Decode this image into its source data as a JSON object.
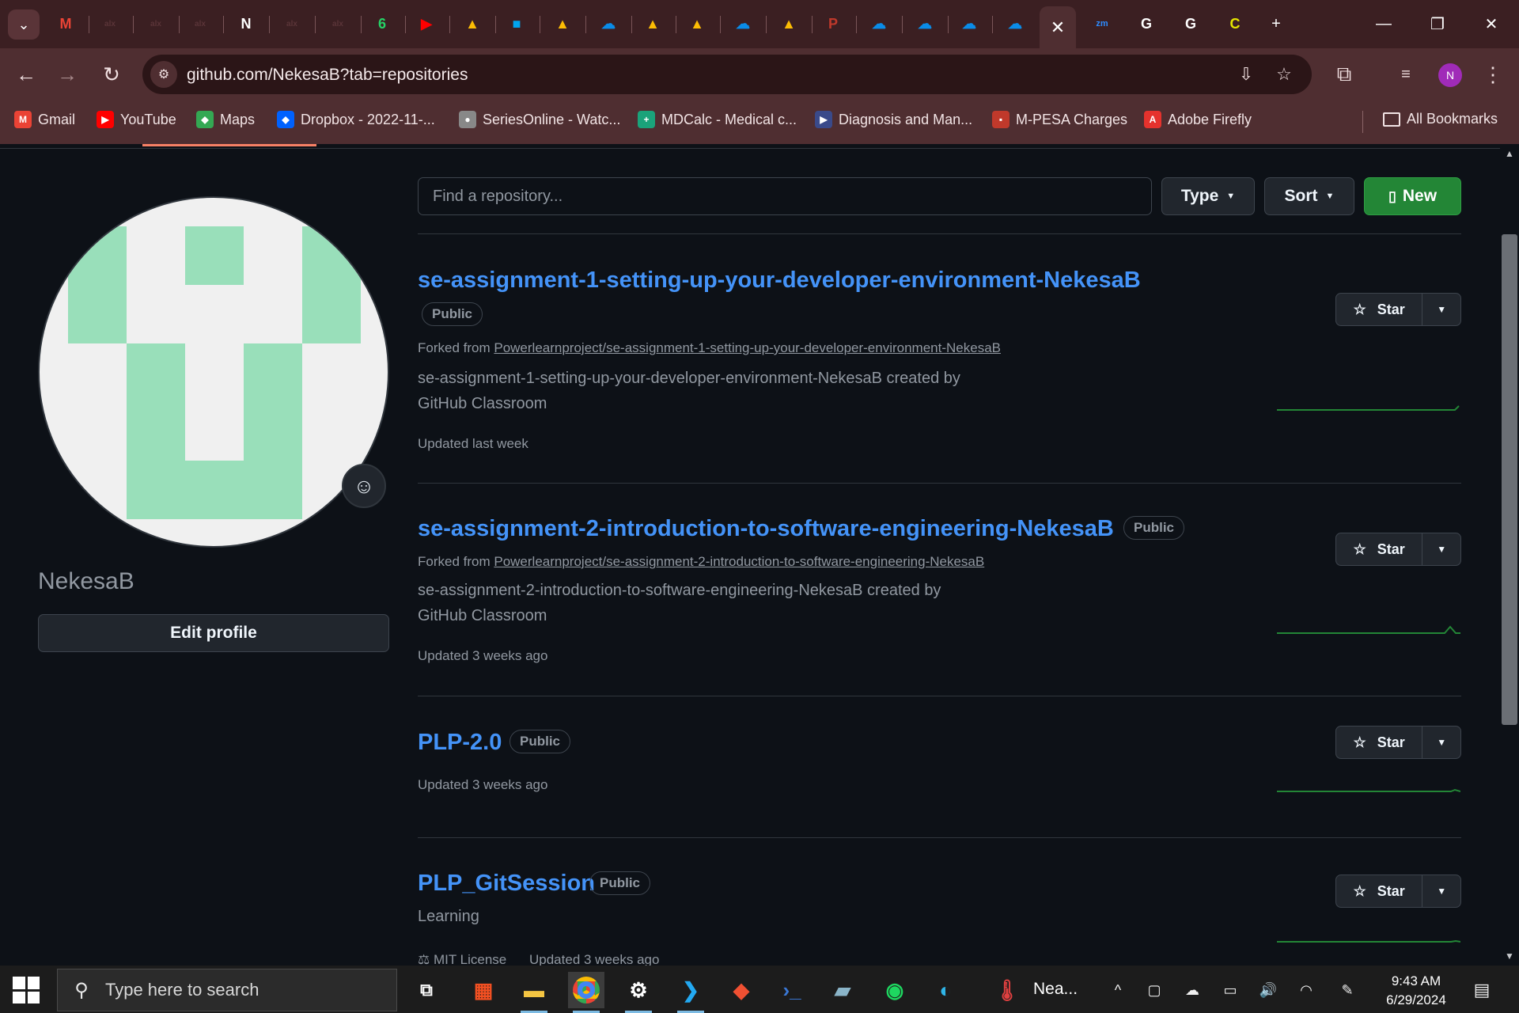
{
  "browser": {
    "active_tab_close": "✕",
    "new_tab": "+",
    "url": "github.com/NekesaB?tab=repositories",
    "profile_initial": "N",
    "tab_favicons": [
      {
        "name": "gmail",
        "color": "#ea4335",
        "glyph": "M"
      },
      {
        "name": "alx-1",
        "color": "#5a3438",
        "glyph": "alx"
      },
      {
        "name": "alx-2",
        "color": "#5a3438",
        "glyph": "alx"
      },
      {
        "name": "alx-3",
        "color": "#5a3438",
        "glyph": "alx"
      },
      {
        "name": "notion",
        "color": "#ffffff",
        "glyph": "N"
      },
      {
        "name": "alx-4",
        "color": "#5a3438",
        "glyph": "alx"
      },
      {
        "name": "alx-5",
        "color": "#5a3438",
        "glyph": "alx"
      },
      {
        "name": "whatsapp",
        "color": "#25d366",
        "glyph": "6"
      },
      {
        "name": "youtube",
        "color": "#ff0000",
        "glyph": "▶"
      },
      {
        "name": "drive-1",
        "color": "#fbbc04",
        "glyph": "▲"
      },
      {
        "name": "microsoft",
        "color": "#00a4ef",
        "glyph": "■"
      },
      {
        "name": "drive-2",
        "color": "#fbbc04",
        "glyph": "▲"
      },
      {
        "name": "onedrive-1",
        "color": "#0a8ce8",
        "glyph": "☁"
      },
      {
        "name": "drive-3",
        "color": "#fbbc04",
        "glyph": "▲"
      },
      {
        "name": "drive-4",
        "color": "#fbbc04",
        "glyph": "▲"
      },
      {
        "name": "onedrive-2",
        "color": "#0a8ce8",
        "glyph": "☁"
      },
      {
        "name": "drive-5",
        "color": "#fbbc04",
        "glyph": "▲"
      },
      {
        "name": "pesa",
        "color": "#c0392b",
        "glyph": "P"
      },
      {
        "name": "onedrive-3",
        "color": "#0a8ce8",
        "glyph": "☁"
      },
      {
        "name": "onedrive-4",
        "color": "#0a8ce8",
        "glyph": "☁"
      },
      {
        "name": "onedrive-5",
        "color": "#0a8ce8",
        "glyph": "☁"
      },
      {
        "name": "onedrive-6",
        "color": "#0a8ce8",
        "glyph": "☁"
      }
    ],
    "tab_favicons_right": [
      {
        "name": "zoom",
        "color": "#2d8cff",
        "glyph": "zm"
      },
      {
        "name": "google-1",
        "color": "#ffffff",
        "glyph": "G"
      },
      {
        "name": "google-2",
        "color": "#ffffff",
        "glyph": "G"
      },
      {
        "name": "extension-yellow",
        "color": "#e6e600",
        "glyph": "C"
      }
    ],
    "bookmarks": [
      {
        "label": "Gmail",
        "color": "#ea4335",
        "glyph": "M"
      },
      {
        "label": "YouTube",
        "color": "#ff0000",
        "glyph": "▶"
      },
      {
        "label": "Maps",
        "color": "#34a853",
        "glyph": "◆"
      },
      {
        "label": "Dropbox - 2022-11-...",
        "color": "#0061fe",
        "glyph": "◆"
      },
      {
        "label": "SeriesOnline - Watc...",
        "color": "#888888",
        "glyph": "●"
      },
      {
        "label": "MDCalc - Medical c...",
        "color": "#1aa37a",
        "glyph": "+"
      },
      {
        "label": "Diagnosis and Man...",
        "color": "#3a4a8a",
        "glyph": "▶"
      },
      {
        "label": "M-PESA Charges",
        "color": "#c0392b",
        "glyph": "▪"
      },
      {
        "label": "Adobe Firefly",
        "color": "#e5322d",
        "glyph": "A"
      }
    ],
    "all_bookmarks": "All Bookmarks"
  },
  "profile": {
    "username": "NekesaB",
    "edit_profile": "Edit profile"
  },
  "filters": {
    "search_placeholder": "Find a repository...",
    "type_label": "Type",
    "sort_label": "Sort",
    "new_label": "New"
  },
  "repositories": [
    {
      "name": "se-assignment-1-setting-up-your-developer-environment-NekesaB",
      "visibility": "Public",
      "forked_prefix": "Forked from ",
      "forked_from": "Powerlearnproject/se-assignment-1-setting-up-your-developer-environment-NekesaB",
      "description": "se-assignment-1-setting-up-your-developer-environment-NekesaB created by GitHub Classroom",
      "updated": "Updated last week",
      "star_label": "Star"
    },
    {
      "name": "se-assignment-2-introduction-to-software-engineering-NekesaB",
      "visibility": "Public",
      "forked_prefix": "Forked from ",
      "forked_from": "Powerlearnproject/se-assignment-2-introduction-to-software-engineering-NekesaB",
      "description": "se-assignment-2-introduction-to-software-engineering-NekesaB created by GitHub Classroom",
      "updated": "Updated 3 weeks ago",
      "star_label": "Star"
    },
    {
      "name": "PLP-2.0",
      "visibility": "Public",
      "updated": "Updated 3 weeks ago",
      "star_label": "Star"
    },
    {
      "name": "PLP_GitSession",
      "visibility": "Public",
      "description": "Learning",
      "license": "MIT License",
      "updated": "Updated 3 weeks ago",
      "star_label": "Star"
    }
  ],
  "taskbar": {
    "search_placeholder": "Type here to search",
    "weather_label": "Nea...",
    "time": "9:43 AM",
    "date": "6/29/2024"
  },
  "colors": {
    "link": "#4493f8",
    "new_button": "#238636",
    "sparkline": "#238636",
    "avatar_identicon": "#99dfba"
  }
}
